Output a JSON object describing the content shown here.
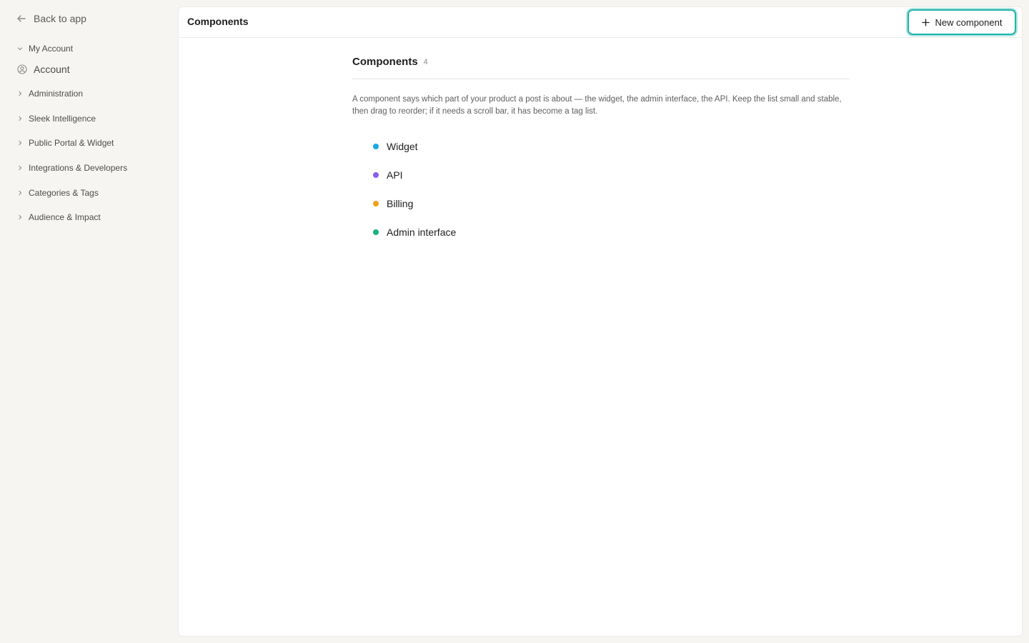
{
  "sidebar": {
    "back_label": "Back to app",
    "groups": [
      {
        "label": "My Account",
        "expanded": true
      },
      {
        "label": "Administration",
        "expanded": false
      },
      {
        "label": "Sleek Intelligence",
        "expanded": false
      },
      {
        "label": "Public Portal & Widget",
        "expanded": false
      },
      {
        "label": "Integrations & Developers",
        "expanded": false
      },
      {
        "label": "Categories & Tags",
        "expanded": false
      },
      {
        "label": "Audience & Impact",
        "expanded": false
      }
    ],
    "account_item": {
      "label": "Account",
      "icon": "user-circle-icon"
    }
  },
  "header": {
    "title": "Components",
    "new_button_label": "New component"
  },
  "section": {
    "title": "Components",
    "count": "4",
    "description": "A component says which part of your product a post is about — the widget, the admin interface, the API. Keep the list small and stable, then drag to reorder; if it needs a scroll bar, it has become a tag list."
  },
  "components": [
    {
      "label": "Widget",
      "color": "#1aa7e6"
    },
    {
      "label": "API",
      "color": "#8b5ce6"
    },
    {
      "label": "Billing",
      "color": "#f0a11a"
    },
    {
      "label": "Admin interface",
      "color": "#18b37c"
    }
  ],
  "colors": {
    "accent": "#1fb3aa",
    "sidebar_bg": "#f6f5f2",
    "panel_bg": "#ffffff"
  }
}
